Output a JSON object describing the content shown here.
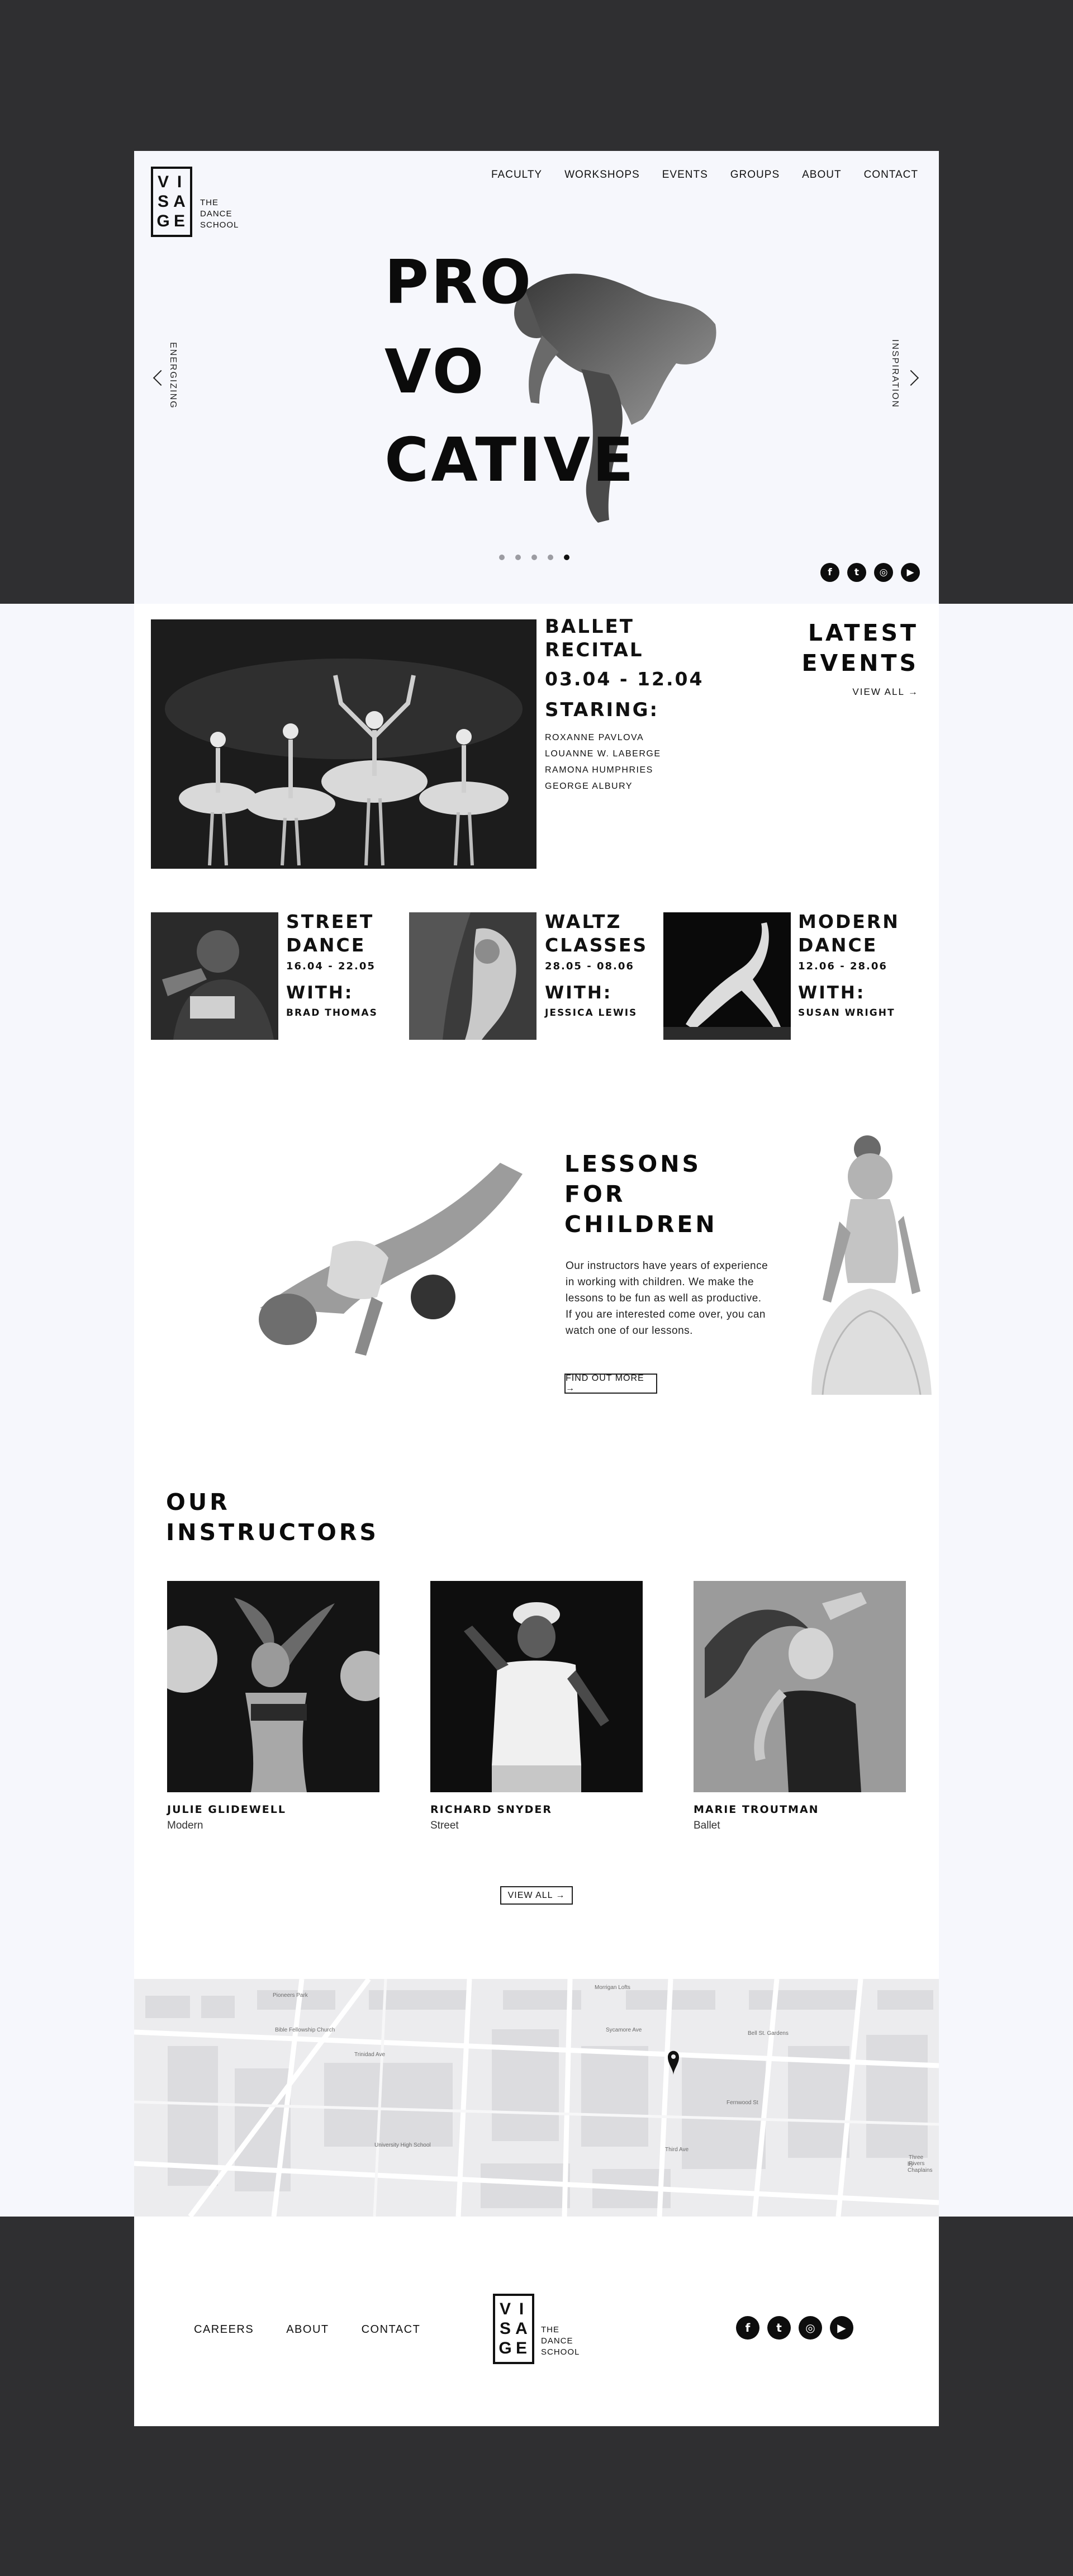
{
  "brand": {
    "logo_letters": [
      "V",
      "I",
      "S",
      "A",
      "G",
      "E"
    ],
    "tagline": [
      "THE",
      "DANCE",
      "SCHOOL"
    ]
  },
  "nav": [
    "FACULTY",
    "WORKSHOPS",
    "EVENTS",
    "GROUPS",
    "ABOUT",
    "CONTACT"
  ],
  "hero": {
    "lines": [
      "PRO",
      "VO",
      "CATIVE"
    ],
    "left_label": "ENERGIZING",
    "right_label": "INSPIRATION",
    "slides_total": 5,
    "active_slide": 5
  },
  "social": [
    "f",
    "t",
    "ig",
    "yt"
  ],
  "latest_events": {
    "heading": [
      "LATEST",
      "EVENTS"
    ],
    "view_all": "VIEW ALL →",
    "featured": {
      "title": [
        "BALLET",
        "RECITAL"
      ],
      "dates": "03.04 - 12.04",
      "staring_label": "STARING:",
      "names": [
        "ROXANNE PAVLOVA",
        "LOUANNE W. LABERGE",
        "RAMONA HUMPHRIES",
        "GEORGE ALBURY"
      ]
    },
    "items": [
      {
        "title": [
          "STREET",
          "DANCE"
        ],
        "dates": "16.04 - 22.05",
        "with_label": "WITH:",
        "with_name": "BRAD THOMAS"
      },
      {
        "title": [
          "WALTZ",
          "CLASSES"
        ],
        "dates": "28.05 - 08.06",
        "with_label": "WITH:",
        "with_name": "JESSICA LEWIS"
      },
      {
        "title": [
          "MODERN",
          "DANCE"
        ],
        "dates": "12.06 - 28.06",
        "with_label": "WITH:",
        "with_name": "SUSAN WRIGHT"
      }
    ]
  },
  "lessons": {
    "heading": [
      "LESSONS",
      "FOR",
      "CHILDREN"
    ],
    "body": [
      "Our instructors have years of experience",
      "in working with children. We make the",
      "lessons to be fun as well as productive.",
      "If you are interested come over, you can",
      "watch one of our lessons."
    ],
    "button": "FIND OUT MORE →"
  },
  "instructors": {
    "heading": [
      "OUR",
      "INSTRUCTORS"
    ],
    "people": [
      {
        "name": "JULIE GLIDEWELL",
        "style": "Modern"
      },
      {
        "name": "RICHARD SNYDER",
        "style": "Street"
      },
      {
        "name": "MARIE TROUTMAN",
        "style": "Ballet"
      }
    ],
    "view_all": "VIEW ALL →"
  },
  "map": {
    "labels": [
      "Pioneers Park",
      "Bible Fellowship Church",
      "Trinidad Ave",
      "University High School",
      "Morrigan Lofts",
      "Bell St. Gardens",
      "Sycamore Ave",
      "Fernwood St",
      "Third Ave",
      "Three Rivers",
      "by Chaplains"
    ]
  },
  "footer": {
    "links": [
      "CAREERS",
      "ABOUT",
      "CONTACT"
    ]
  }
}
